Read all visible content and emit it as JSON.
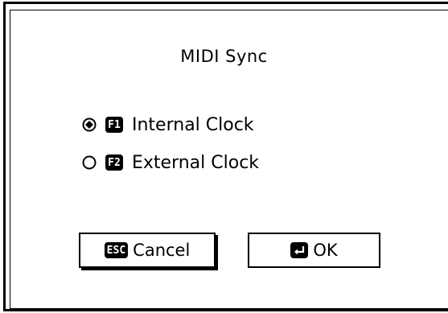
{
  "dialog": {
    "title": "MIDI Sync",
    "options": [
      {
        "key": "F1",
        "label": "Internal Clock",
        "selected": true
      },
      {
        "key": "F2",
        "label": "External Clock",
        "selected": false
      }
    ],
    "buttons": {
      "cancel": {
        "key": "ESC",
        "label": "Cancel"
      },
      "ok": {
        "key_icon": "enter-icon",
        "label": "OK"
      }
    }
  }
}
